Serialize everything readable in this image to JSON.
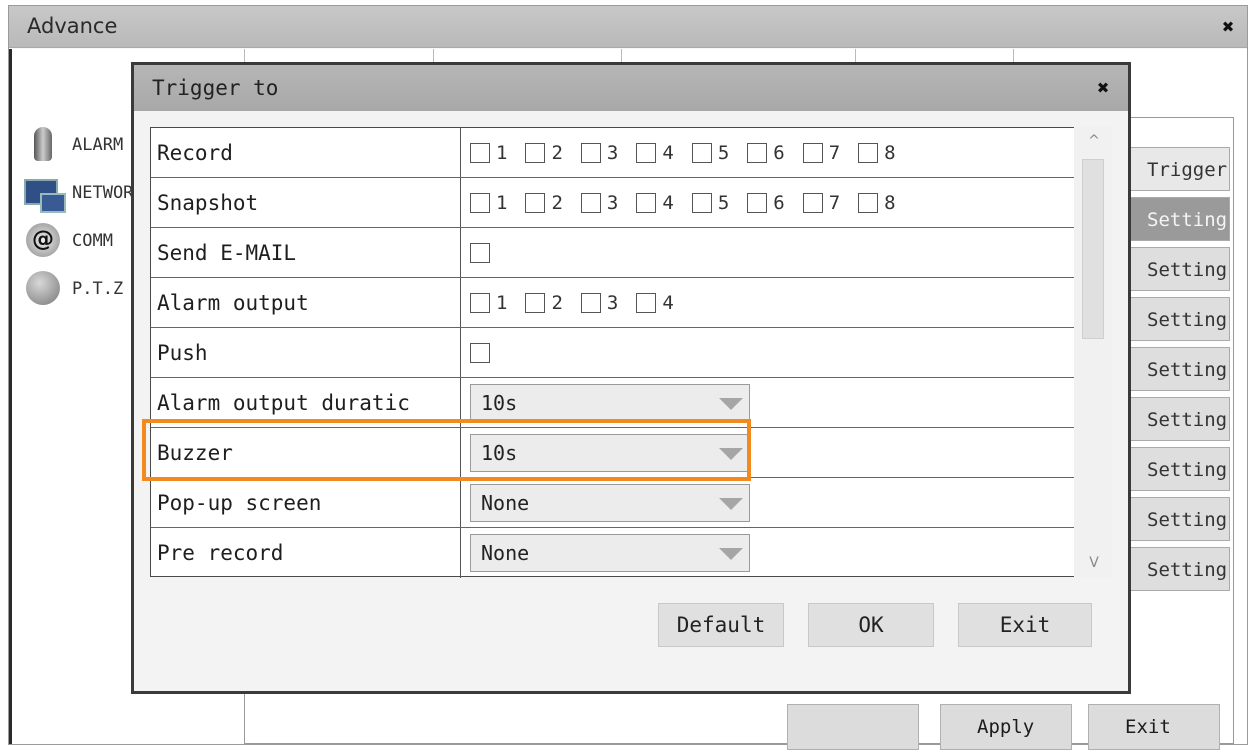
{
  "advance_window": {
    "title": "Advance",
    "side_menu": [
      {
        "label": "ALARM",
        "icon": "alarm-icon"
      },
      {
        "label": "NETWORK",
        "icon": "network-icon"
      },
      {
        "label": "COMM",
        "icon": "comm-icon"
      },
      {
        "label": "P.T.Z",
        "icon": "ptz-icon"
      }
    ],
    "right_buttons": [
      "Trigger",
      "Settings",
      "Settings",
      "Settings",
      "Settings",
      "Settings",
      "Settings",
      "Settings",
      "Settings"
    ],
    "bottom_buttons": [
      "",
      "Apply",
      "Exit"
    ]
  },
  "dialog": {
    "title": "Trigger to",
    "close_icon": "close-icon",
    "rows": [
      {
        "label": "Record",
        "type": "checkboxes",
        "options": [
          "1",
          "2",
          "3",
          "4",
          "5",
          "6",
          "7",
          "8"
        ]
      },
      {
        "label": "Snapshot",
        "type": "checkboxes",
        "options": [
          "1",
          "2",
          "3",
          "4",
          "5",
          "6",
          "7",
          "8"
        ]
      },
      {
        "label": "Send E-MAIL",
        "type": "checkbox"
      },
      {
        "label": "Alarm output",
        "type": "checkboxes",
        "options": [
          "1",
          "2",
          "3",
          "4"
        ]
      },
      {
        "label": "Push",
        "type": "checkbox"
      },
      {
        "label": "Alarm output duratic",
        "type": "select",
        "value": "10s"
      },
      {
        "label": "Buzzer",
        "type": "select",
        "value": "10s"
      },
      {
        "label": "Pop-up screen",
        "type": "select",
        "value": "None"
      },
      {
        "label": "Pre record",
        "type": "select",
        "value": "None"
      }
    ],
    "buttons": {
      "default": "Default",
      "ok": "OK",
      "exit": "Exit"
    },
    "scroll": {
      "up": "^",
      "down": "V"
    }
  },
  "colors": {
    "highlight": "#f28a1e",
    "titlebar": "#b0b0b0"
  }
}
